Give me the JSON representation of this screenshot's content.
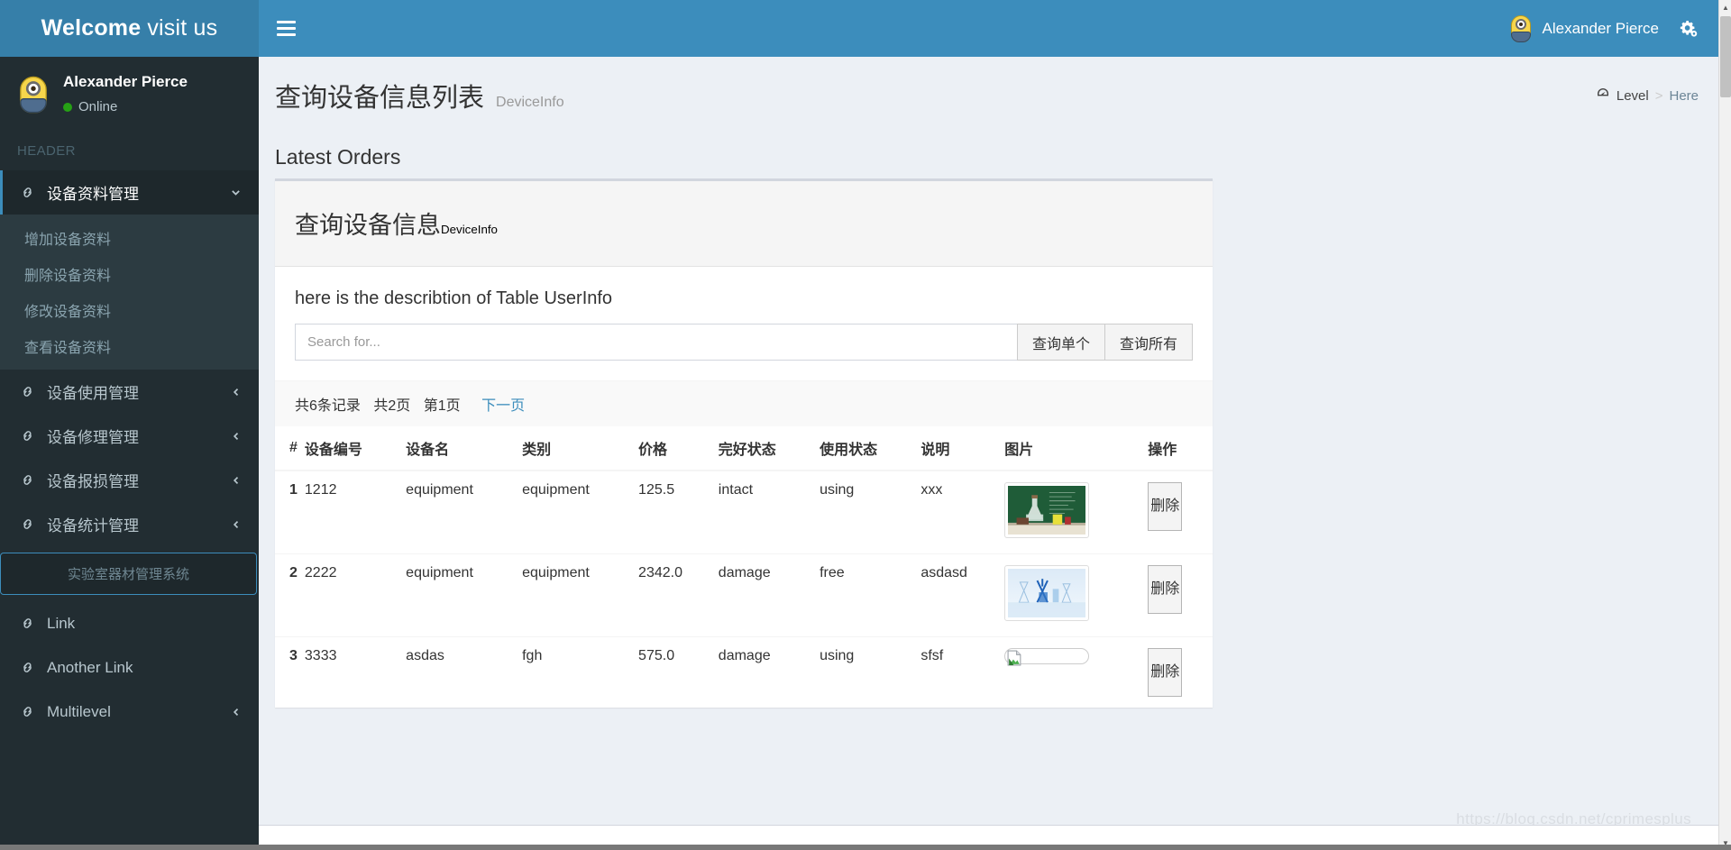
{
  "logo": {
    "bold": "Welcome",
    "light": "visit us"
  },
  "navbar": {
    "hamburger_icon": "bars-icon",
    "user_name": "Alexander Pierce",
    "gears_icon": "gears-icon"
  },
  "sidebar": {
    "user_panel": {
      "name": "Alexander Pierce",
      "status": "Online",
      "avatar_icon": "minion-avatar"
    },
    "header_label": "HEADER",
    "items": [
      {
        "label": "设备资料管理",
        "icon": "link-icon",
        "arrow": "chevron-down-icon",
        "active": true
      },
      {
        "label": "设备使用管理",
        "icon": "link-icon",
        "arrow": "chevron-left-icon",
        "active": false
      },
      {
        "label": "设备修理管理",
        "icon": "link-icon",
        "arrow": "chevron-left-icon",
        "active": false
      },
      {
        "label": "设备报损管理",
        "icon": "link-icon",
        "arrow": "chevron-left-icon",
        "active": false
      },
      {
        "label": "设备统计管理",
        "icon": "link-icon",
        "arrow": "chevron-left-icon",
        "active": false
      }
    ],
    "submenu": [
      {
        "label": "增加设备资料"
      },
      {
        "label": "删除设备资料"
      },
      {
        "label": "修改设备资料"
      },
      {
        "label": "查看设备资料"
      }
    ],
    "brand_box": "实验室器材管理系统",
    "bottom_items": [
      {
        "label": "Link",
        "icon": "link-icon",
        "arrow": ""
      },
      {
        "label": "Another Link",
        "icon": "link-icon",
        "arrow": ""
      },
      {
        "label": "Multilevel",
        "icon": "link-icon",
        "arrow": "chevron-left-icon"
      }
    ]
  },
  "content": {
    "page_title": "查询设备信息列表",
    "page_subtitle": "DeviceInfo",
    "breadcrumb": {
      "icon": "dashboard-icon",
      "level": "Level",
      "separator": ">",
      "here": "Here"
    },
    "section_title": "Latest Orders",
    "box": {
      "title": "查询设备信息",
      "subtitle": "DeviceInfo",
      "description": "here is the describtion of Table UserInfo",
      "search": {
        "placeholder": "Search for...",
        "value": "",
        "btn_single": "查询单个",
        "btn_all": "查询所有"
      },
      "pager": {
        "total_records": "共6条记录",
        "total_pages": "共2页",
        "current_page": "第1页",
        "next_link": "下一页"
      },
      "table": {
        "headers": [
          "#",
          "设备编号",
          "设备名",
          "类别",
          "价格",
          "完好状态",
          "使用状态",
          "说明",
          "图片",
          "操作"
        ],
        "rows": [
          {
            "num": "1",
            "device_id": "1212",
            "device_name": "equipment",
            "category": "equipment",
            "price": "125.5",
            "condition": "intact",
            "usage": "using",
            "remark": "xxx",
            "image": "lab-chalkboard-photo",
            "action": "删除"
          },
          {
            "num": "2",
            "device_id": "2222",
            "device_name": "equipment",
            "category": "equipment",
            "price": "2342.0",
            "condition": "damage",
            "usage": "free",
            "remark": "asdasd",
            "image": "blue-glassware-photo",
            "action": "删除"
          },
          {
            "num": "3",
            "device_id": "3333",
            "device_name": "asdas",
            "category": "fgh",
            "price": "575.0",
            "condition": "damage",
            "usage": "using",
            "remark": "sfsf",
            "image": "broken-image-placeholder",
            "action": "删除"
          }
        ]
      }
    }
  },
  "watermark": "https://blog.csdn.net/cprimesplus",
  "colors": {
    "navbar": "#3c8dbc",
    "logo_bar": "#367fa9",
    "sidebar": "#222d32",
    "submenu": "#2c3b41",
    "content_bg": "#ecf0f5",
    "link": "#3c8dbc",
    "online": "#26a115"
  }
}
